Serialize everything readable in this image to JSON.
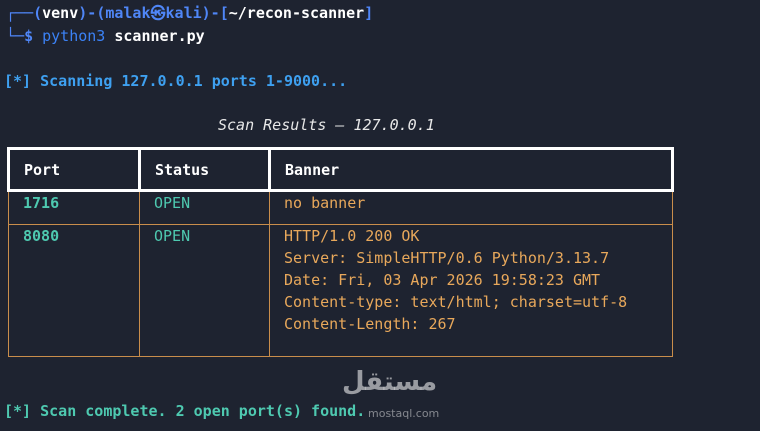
{
  "prompt": {
    "corner_top": "┌──",
    "open_paren": "(",
    "venv": "venv",
    "close_paren": ")",
    "dash": "-",
    "user_open": "(",
    "user": "malak",
    "at": "㉿",
    "host": "kali",
    "user_close": ")",
    "dir_open": "-[",
    "dir": "~/recon-scanner",
    "dir_close": "]",
    "corner_bottom": "└─",
    "dollar": "$",
    "command": "python3",
    "argument": "scanner.py"
  },
  "scan_message": "[*] Scanning 127.0.0.1 ports 1-9000...",
  "table": {
    "title": "Scan Results — 127.0.0.1",
    "headers": [
      "Port",
      "Status",
      "Banner"
    ],
    "rows": [
      {
        "port": "1716",
        "status": "OPEN",
        "banner": [
          "no banner"
        ]
      },
      {
        "port": "8080",
        "status": "OPEN",
        "banner": [
          "HTTP/1.0 200 OK",
          "Server: SimpleHTTP/0.6 Python/3.13.7",
          "Date: Fri, 03 Apr 2026 19:58:23 GMT",
          "Content-type: text/html; charset=utf-8",
          "Content-Length: 267"
        ]
      }
    ]
  },
  "complete_message": "[*] Scan complete. 2 open port(s) found.",
  "watermark": {
    "text": "مستقل",
    "sub": "mostaql.com"
  },
  "colors": {
    "background": "#1e2330",
    "prompt_blue": "#4f86f7",
    "info_blue": "#3ea0f0",
    "open_green": "#4ec9b0",
    "banner_orange": "#e8a85b"
  }
}
